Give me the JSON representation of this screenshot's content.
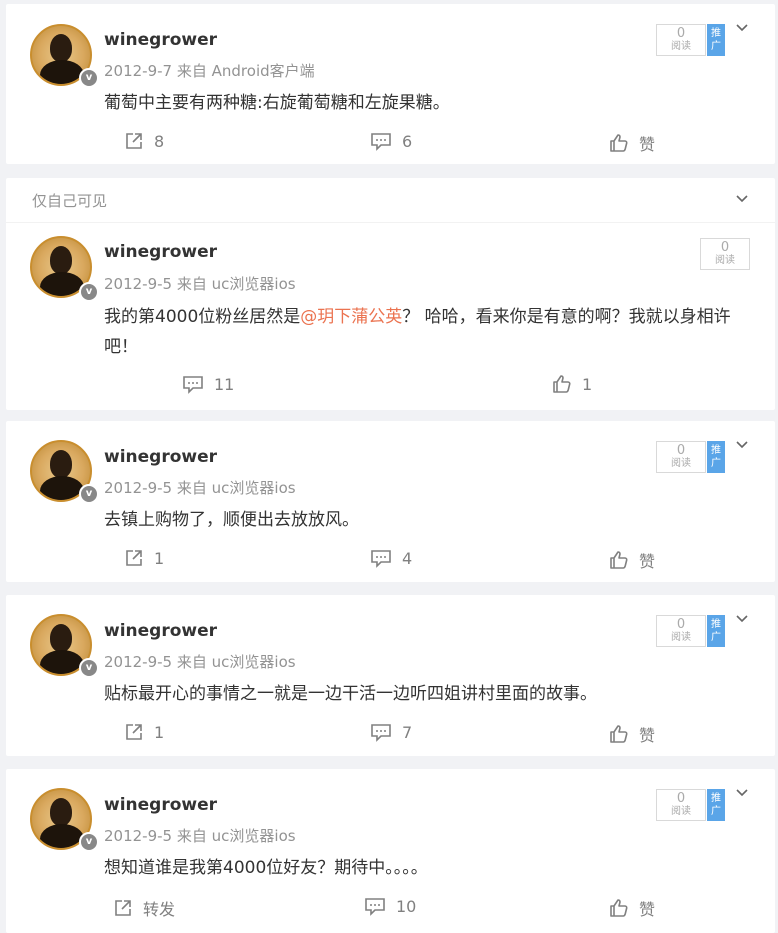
{
  "posts": [
    {
      "username": "winegrower",
      "date": "2012-9-7",
      "source": "来自 Android客户端",
      "text_before": "葡萄中主要有两种糖:右旋葡萄糖和左旋果糖。",
      "mention": "",
      "text_after": "",
      "read_count": "0",
      "read_label": "阅读",
      "promo_label": "推广",
      "repost": "8",
      "comment": "6",
      "like": "赞"
    },
    {
      "visibility": "仅自己可见",
      "username": "winegrower",
      "date": "2012-9-5",
      "source": "来自 uc浏览器ios",
      "text_before": "我的第4000位粉丝居然是",
      "mention": "@玥下蒲公英",
      "text_after": "？ 哈哈，看来你是有意的啊？我就以身相许吧！",
      "read_count": "0",
      "read_label": "阅读",
      "comment": "11",
      "like": "1"
    },
    {
      "username": "winegrower",
      "date": "2012-9-5",
      "source": "来自 uc浏览器ios",
      "text_before": "去镇上购物了，顺便出去放放风。",
      "mention": "",
      "text_after": "",
      "read_count": "0",
      "read_label": "阅读",
      "promo_label": "推广",
      "repost": "1",
      "comment": "4",
      "like": "赞"
    },
    {
      "username": "winegrower",
      "date": "2012-9-5",
      "source": "来自 uc浏览器ios",
      "text_before": "贴标最开心的事情之一就是一边干活一边听四姐讲村里面的故事。",
      "mention": "",
      "text_after": "",
      "read_count": "0",
      "read_label": "阅读",
      "promo_label": "推广",
      "repost": "1",
      "comment": "7",
      "like": "赞"
    },
    {
      "username": "winegrower",
      "date": "2012-9-5",
      "source": "来自 uc浏览器ios",
      "text_before": "想知道谁是我第4000位好友？期待中。。。。",
      "mention": "",
      "text_after": "",
      "read_count": "0",
      "read_label": "阅读",
      "promo_label": "推广",
      "repost": "转发",
      "comment": "10",
      "like": "赞"
    }
  ],
  "colors": {
    "mention": "#eb7350",
    "promo": "#5aa5e8",
    "meta": "#939393"
  }
}
